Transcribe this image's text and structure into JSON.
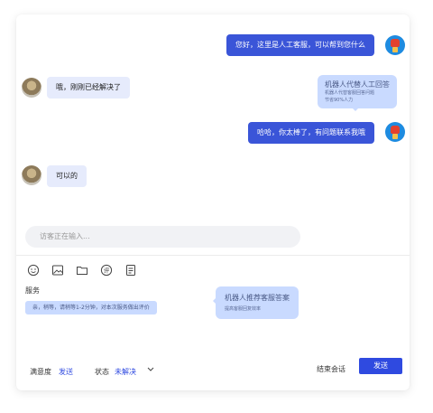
{
  "messages": {
    "greeting": "您好，这里是人工客服，可以帮到您什么",
    "agent_reply": "哦，刚刚已经解决了",
    "user_praise": "哈哈，你太棒了，有问题联系我哦",
    "agent_ok": "可以的"
  },
  "tips": {
    "bot_agent_title": "机器人代替人工回答",
    "bot_agent_sub_1": "机器人代替客服回答问题",
    "bot_agent_sub_2": "节省90%人力",
    "recommend_title": "机器人推荐客服答案",
    "recommend_sub": "提高客服回复效率"
  },
  "input": {
    "typing_placeholder": "访客正在输入..."
  },
  "toolbar": {
    "icons": [
      "smile-icon",
      "image-icon",
      "folder-icon",
      "evaluate-icon",
      "document-icon"
    ]
  },
  "service": {
    "label": "服务",
    "message": "亲，稍等，请稍等1-2分钟，对本次服务做出评价"
  },
  "footer": {
    "satisfaction_label": "满意度",
    "satisfaction_action": "发送",
    "status_label": "状态",
    "status_value": "未解决",
    "end_session": "结束会话",
    "send": "发送"
  },
  "colors": {
    "accent": "#2f4ae0",
    "bubble_right": "#3a55d8",
    "bubble_left": "#e6ebfc",
    "tip": "#c9daff"
  }
}
